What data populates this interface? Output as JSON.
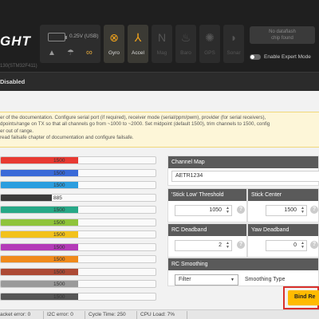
{
  "header": {
    "logo_text": "GHT",
    "firmware_text": "130(STM32F411)",
    "voltage": "0.25V (USB)",
    "icons": [
      "battery-icon",
      "warning-icon",
      "parachute-icon",
      "link-icon"
    ],
    "sensors": [
      {
        "label": "Gyro",
        "icon": "gyro-icon",
        "active": true
      },
      {
        "label": "Accel",
        "icon": "accel-icon",
        "active": true
      },
      {
        "label": "Mag",
        "icon": "mag-icon",
        "active": false
      },
      {
        "label": "Baro",
        "icon": "baro-icon",
        "active": false
      },
      {
        "label": "GPS",
        "icon": "gps-icon",
        "active": false
      },
      {
        "label": "Sonar",
        "icon": "sonar-icon",
        "active": false
      }
    ],
    "dataflash_line1": "No dataflash",
    "dataflash_line2": "chip found",
    "expert_mode_label": "Enable Expert Mode",
    "accent_color": "#f4a51c"
  },
  "armed_status": "Disabled",
  "note": {
    "line1": "er of the documentation. Configure serial port (if required), receiver mode (serial/ppm/pwm), provider (for serial receivers),",
    "line2": "dpoints/range on TX so that all channels go from ~1000 to ~2000. Set midpoint (default 1500), trim channels to 1500, config",
    "line3": "er out of range.",
    "line4": "read failsafe chapter of documentation and configure failsafe."
  },
  "channels": [
    {
      "value": "1500",
      "color": "#e83a32",
      "fill": 0.5
    },
    {
      "value": "1500",
      "color": "#3a6ad8",
      "fill": 0.5
    },
    {
      "value": "1500",
      "color": "#2c9edf",
      "fill": 0.5
    },
    {
      "value": "885",
      "color": "#3b3b3b",
      "fill": 0.33
    },
    {
      "value": "1500",
      "color": "#27a887",
      "fill": 0.5
    },
    {
      "value": "1500",
      "color": "#8fc43a",
      "fill": 0.5
    },
    {
      "value": "1500",
      "color": "#f2c21c",
      "fill": 0.5
    },
    {
      "value": "1500",
      "color": "#b43bb8",
      "fill": 0.5
    },
    {
      "value": "1500",
      "color": "#f08a1c",
      "fill": 0.5
    },
    {
      "value": "1500",
      "color": "#ad4a35",
      "fill": 0.5
    },
    {
      "value": "1500",
      "color": "#9a9a9a",
      "fill": 0.5
    },
    {
      "value": "1500",
      "color": "#555555",
      "fill": 0.5
    }
  ],
  "channel_map": {
    "title": "Channel Map",
    "value": "AETR1234"
  },
  "stick_low": {
    "title": "'Stick Low' Threshold",
    "value": "1050"
  },
  "stick_center": {
    "title": "Stick Center",
    "value": "1500"
  },
  "rc_deadband": {
    "title": "RC Deadband",
    "value": "2"
  },
  "yaw_deadband": {
    "title": "Yaw Deadband",
    "value": "0"
  },
  "rc_smoothing": {
    "title": "RC Smoothing",
    "select_value": "Filter",
    "type_label": "Smoothing Type"
  },
  "bind_button": "Bind Re",
  "statusbar": {
    "packet_error": "acket error: 0",
    "i2c_error": "I2C error: 0",
    "cycle_time": "Cycle Time: 250",
    "cpu_load": "CPU Load: 7%"
  }
}
